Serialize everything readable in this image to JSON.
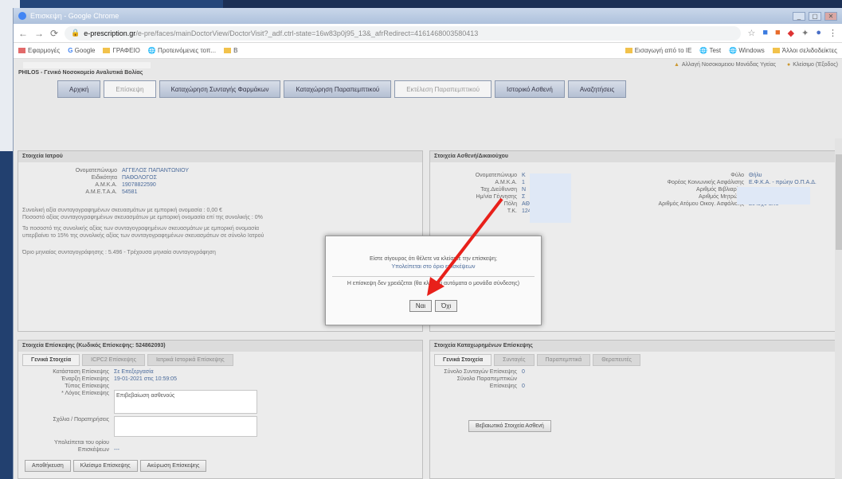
{
  "window": {
    "title": "Επισκεψη - Google Chrome",
    "controls": [
      "_",
      "▢",
      "✕"
    ]
  },
  "browser": {
    "url_host": "e-prescription.gr",
    "url_path": "/e-pre/faces/mainDoctorView/DoctorVisit?_adf.ctrl-state=16w83p0j95_13&_afrRedirect=4161468003580413",
    "bookmarks": [
      "Εφαρμογές",
      "Google",
      "ΓΡΑΦΕΙΟ",
      "Προτεινόμενες τοπ...",
      "Β"
    ],
    "bookmarks_right": [
      "Εισαγωγή από το IE",
      "Test",
      "Windows",
      "Άλλοι σελιδοδείκτες"
    ]
  },
  "page": {
    "role": "PHILOS - Γενικό Νοσοκομείο Αναλυτικά Βολίας",
    "header_right_1": "Αλλαγή Νοσοκομειου Μονάδας Υγείας",
    "header_right_2": "Κλείσιμο (Έξοδος)",
    "tabs": [
      "Αρχική",
      "Επίσκεψη",
      "Καταχώρηση Συνταγής Φαρμάκων",
      "Καταχώρηση Παραπεμπτικού",
      "Εκτέλεση Παραπεμπτικού",
      "Ιστορικό Ασθενή",
      "Αναζητήσεις"
    ]
  },
  "doctor": {
    "title": "Στοιχεία Ιατρού",
    "rows": [
      {
        "k": "Ονοματεπώνυμο",
        "v": "ΑΓΓΕΛΟΣ ΠΑΠΑΝΤΩΝΙΟΥ"
      },
      {
        "k": "Ειδικότητα",
        "v": "ΠΑΘΟΛΟΓΟΣ"
      },
      {
        "k": "Α.Μ.Κ.Α.",
        "v": "19078822590"
      },
      {
        "k": "Α.Μ.Ε.Τ.Α.Α.",
        "v": "54581"
      }
    ],
    "lines": [
      "Συνολική αξία συνταγογραφημένων σκευασμάτων με εμπορική ονομασία : 0,00 €",
      "Ποσοστό αξίας συνταγογραφημένων σκευασμάτων με εμπορική ονομασία επί της συνολικής : 0%",
      "Το ποσοστό της συνολικής αξίας των συνταγογραφημένων σκευασμάτων με εμπορική ονομασία",
      "υπερβαίνει το 15% της συνολικής αξίας των συνταγογραφημένων σκευασμάτων σε σύνολο Ιατρού",
      "Όριο μηνιαίας συνταγογράφησης : 5.496 - Τρέχουσα μηνιαία συνταγογράφηση"
    ]
  },
  "patient": {
    "title": "Στοιχεία Ασθενή/Δικαιούχου",
    "left": [
      {
        "k": "Ονοματεπώνυμο",
        "v": "Κ"
      },
      {
        "k": "Α.Μ.Κ.Α.",
        "v": "1"
      },
      {
        "k": "Ταχ.Διεύθυνση",
        "v": "Ν"
      },
      {
        "k": "Ημ/νία Γέννησης",
        "v": "Σ"
      },
      {
        "k": "Πόλη",
        "v": "ΑΘ"
      },
      {
        "k": "Τ.Κ.",
        "v": "12461"
      }
    ],
    "right": [
      {
        "k": "Φύλο",
        "v": "Θήλυ"
      },
      {
        "k": "Φορέας Κοινωνικής Ασφάλισης",
        "v": "Ε.Φ.Κ.Α. - πρώην Ο.Π.Α.Δ."
      },
      {
        "k": "Αριθμός Βιβλιαρίου",
        "v": ""
      },
      {
        "k": "Αριθμός Μητρώου",
        "v": ""
      },
      {
        "k": "Αριθμός Ατόμου Οικογ. Ασφάλισης",
        "v": "Σε ισχύ από"
      }
    ]
  },
  "visit": {
    "title": "Στοιχεία Επίσκεψης (Κωδικός Επίσκεψης: 524862093)",
    "tabs": [
      "Γενικά Στοιχεία",
      "ICPC2 Επίσκεψης",
      "Ιατρικά Ιστορικά Επίσκεψης"
    ],
    "rows": [
      {
        "k": "Κατάσταση Επίσκεψης",
        "v": "Σε Επεξεργασία"
      },
      {
        "k": "Έναρξη Επίσκεψης",
        "v": "19-01-2021 στις 10:59:05"
      },
      {
        "k": "Τύπος Επίσκεψης",
        "v": ""
      },
      {
        "k": "* Λόγος Επίσκεψης",
        "v": "Επιβεβαίωση ασθενούς"
      },
      {
        "k": "Σχόλια / Παρατηρήσεις",
        "v": ""
      },
      {
        "k": "Υπολείπεται του ορίου Επισκέψεων",
        "v": "---"
      }
    ],
    "buttons": [
      "Αποθήκευση",
      "Κλείσιμο Επίσκεψης",
      "Ακύρωση Επίσκεψης"
    ]
  },
  "prescriptions": {
    "title": "Στοιχεία Καταχωρημένων Επίσκεψης",
    "tabs": [
      "Γενικά Στοιχεία",
      "Συνταγές",
      "Παραπεμπτικά",
      "Θεραπευτές"
    ],
    "rows": [
      {
        "k": "Σύνολο Συνταγών Επίσκεψης",
        "v": "0"
      },
      {
        "k": "Σύνολο Παραπεμπτικών Επίσκεψης",
        "v": "0"
      }
    ],
    "button": "Βεβαιωτικό Στοιχεία Ασθενή"
  },
  "dialog": {
    "line1": "Είστε σίγουρος ότι θέλετε να κλείσετε την επίσκεψη;",
    "line2": "Υπολείπεται στο όριο επισκέψεων",
    "line3": "Η επίσκεψη δεν χρειάζεται (θα κλειστεί αυτόματα ο μονάδα σύνδεσης)",
    "yes": "Ναι",
    "no": "Όχι"
  },
  "accent": {
    "arrow": "#e8201a",
    "tab_gradient": "#b5c0d3",
    "mask": "#dfe8f6"
  }
}
